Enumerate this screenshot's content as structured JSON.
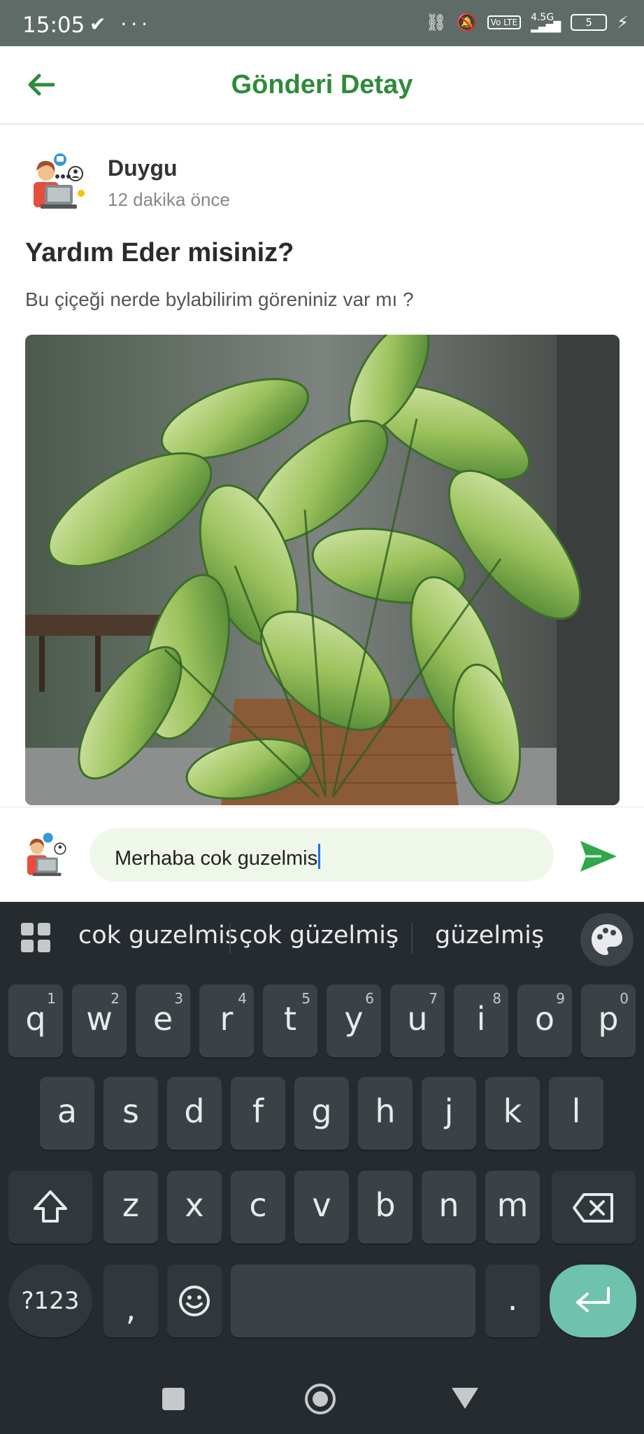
{
  "status_bar": {
    "time": "15:05",
    "left_icons": "✔ ···",
    "badge": "Vo LTE",
    "network": "4.5G",
    "battery": "5"
  },
  "app_bar": {
    "title": "Gönderi Detay"
  },
  "post": {
    "author": "Duygu",
    "time_ago": "12 dakika önce",
    "title": "Yardım Eder misiniz?",
    "body": "Bu çiçeği nerde bylabilirim göreniniz var mı ?"
  },
  "comment": {
    "value": "Merhaba cok guzelmis"
  },
  "keyboard": {
    "suggestions": [
      "cok guzelmis",
      "çok güzelmiş",
      "güzelmiş"
    ],
    "row1": [
      {
        "k": "q",
        "h": "1"
      },
      {
        "k": "w",
        "h": "2"
      },
      {
        "k": "e",
        "h": "3"
      },
      {
        "k": "r",
        "h": "4"
      },
      {
        "k": "t",
        "h": "5"
      },
      {
        "k": "y",
        "h": "6"
      },
      {
        "k": "u",
        "h": "7"
      },
      {
        "k": "i",
        "h": "8"
      },
      {
        "k": "o",
        "h": "9"
      },
      {
        "k": "p",
        "h": "0"
      }
    ],
    "row2": [
      "a",
      "s",
      "d",
      "f",
      "g",
      "h",
      "j",
      "k",
      "l"
    ],
    "row3": [
      "z",
      "x",
      "c",
      "v",
      "b",
      "n",
      "m"
    ],
    "symbols": "?123",
    "comma": ",",
    "period": "."
  }
}
